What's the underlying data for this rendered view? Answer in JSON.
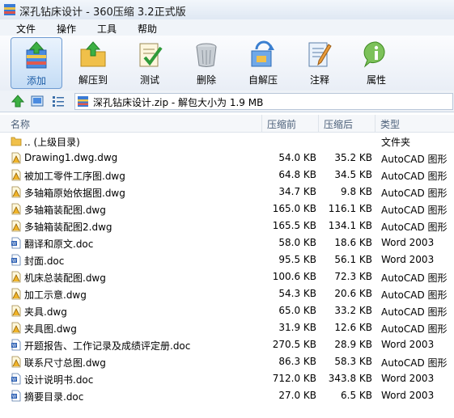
{
  "window": {
    "title": "深孔钻床设计 - 360压缩 3.2正式版"
  },
  "menu": [
    "文件",
    "操作",
    "工具",
    "帮助"
  ],
  "toolbar": [
    {
      "label": "添加",
      "icon": "add-archive-icon"
    },
    {
      "label": "解压到",
      "icon": "extract-to-icon"
    },
    {
      "label": "测试",
      "icon": "test-icon"
    },
    {
      "label": "删除",
      "icon": "delete-icon"
    },
    {
      "label": "自解压",
      "icon": "self-extract-icon"
    },
    {
      "label": "注释",
      "icon": "comment-icon"
    },
    {
      "label": "属性",
      "icon": "info-icon"
    }
  ],
  "address": "深孔钻床设计.zip - 解包大小为 1.9 MB",
  "columns": {
    "name": "名称",
    "compressed_before": "压缩前",
    "compressed_after": "压缩后",
    "type": "类型"
  },
  "files": [
    {
      "name": ".. (上级目录)",
      "size": "",
      "csize": "",
      "type": "文件夹",
      "kind": "folder"
    },
    {
      "name": "Drawing1.dwg.dwg",
      "size": "54.0 KB",
      "csize": "35.2 KB",
      "type": "AutoCAD 图形",
      "kind": "dwg"
    },
    {
      "name": "被加工零件工序图.dwg",
      "size": "64.8 KB",
      "csize": "34.5 KB",
      "type": "AutoCAD 图形",
      "kind": "dwg"
    },
    {
      "name": "多轴箱原始依据图.dwg",
      "size": "34.7 KB",
      "csize": "9.8 KB",
      "type": "AutoCAD 图形",
      "kind": "dwg"
    },
    {
      "name": "多轴箱装配图.dwg",
      "size": "165.0 KB",
      "csize": "116.1 KB",
      "type": "AutoCAD 图形",
      "kind": "dwg"
    },
    {
      "name": "多轴箱装配图2.dwg",
      "size": "165.5 KB",
      "csize": "134.1 KB",
      "type": "AutoCAD 图形",
      "kind": "dwg"
    },
    {
      "name": "翻译和原文.doc",
      "size": "58.0 KB",
      "csize": "18.6 KB",
      "type": "Word 2003",
      "kind": "doc"
    },
    {
      "name": "封面.doc",
      "size": "95.5 KB",
      "csize": "56.1 KB",
      "type": "Word 2003",
      "kind": "doc"
    },
    {
      "name": "机床总装配图.dwg",
      "size": "100.6 KB",
      "csize": "72.3 KB",
      "type": "AutoCAD 图形",
      "kind": "dwg"
    },
    {
      "name": "加工示意.dwg",
      "size": "54.3 KB",
      "csize": "20.6 KB",
      "type": "AutoCAD 图形",
      "kind": "dwg"
    },
    {
      "name": "夹具.dwg",
      "size": "65.0 KB",
      "csize": "33.2 KB",
      "type": "AutoCAD 图形",
      "kind": "dwg"
    },
    {
      "name": "夹具图.dwg",
      "size": "31.9 KB",
      "csize": "12.6 KB",
      "type": "AutoCAD 图形",
      "kind": "dwg"
    },
    {
      "name": "开题报告、工作记录及成绩评定册.doc",
      "size": "270.5 KB",
      "csize": "28.9 KB",
      "type": "Word 2003",
      "kind": "doc"
    },
    {
      "name": "联系尺寸总图.dwg",
      "size": "86.3 KB",
      "csize": "58.3 KB",
      "type": "AutoCAD 图形",
      "kind": "dwg"
    },
    {
      "name": "设计说明书.doc",
      "size": "712.0 KB",
      "csize": "343.8 KB",
      "type": "Word 2003",
      "kind": "doc"
    },
    {
      "name": "摘要目录.doc",
      "size": "27.0 KB",
      "csize": "6.5 KB",
      "type": "Word 2003",
      "kind": "doc"
    }
  ]
}
